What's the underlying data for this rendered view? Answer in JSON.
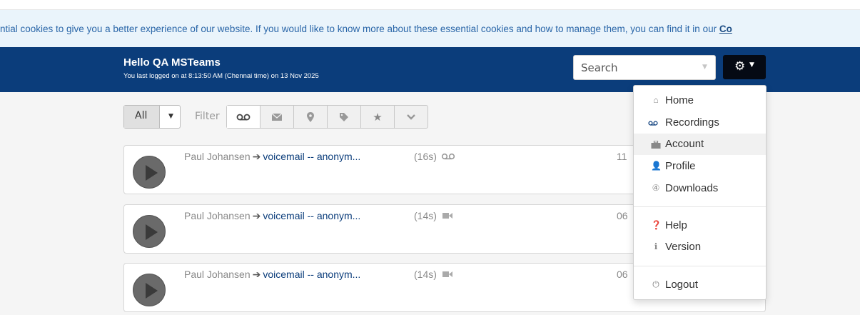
{
  "cookie_banner": {
    "text": "ntial cookies to give you a better experience of our website. If you would like to know more about these essential cookies and how to manage them, you can find it in our ",
    "link": "Co"
  },
  "navbar": {
    "greeting": "Hello QA MSTeams",
    "last_login": "You last logged on at 8:13:50 AM (Chennai time) on 13 Nov 2025",
    "search_placeholder": "Search",
    "gear_icon": "gear-icon"
  },
  "toolbar": {
    "all_label": "All",
    "filter_label": "Filter",
    "filter_icons": [
      "voicemail-icon",
      "envelope-icon",
      "map-marker-icon",
      "tag-icon",
      "star-icon",
      "chevron-down-icon"
    ]
  },
  "messages": [
    {
      "from": "Paul Johansen",
      "to": "voicemail -- anonym...",
      "duration": "(16s)",
      "type_icon": "voicemail-icon",
      "date": "11"
    },
    {
      "from": "Paul Johansen",
      "to": "voicemail -- anonym...",
      "duration": "(14s)",
      "type_icon": "video-icon",
      "date": "06"
    },
    {
      "from": "Paul Johansen",
      "to": "voicemail -- anonym...",
      "duration": "(14s)",
      "type_icon": "video-icon",
      "date": "06"
    }
  ],
  "menu": {
    "items": [
      {
        "label": "Home",
        "icon": "home-icon"
      },
      {
        "label": "Recordings",
        "icon": "voicemail-icon"
      },
      {
        "label": "Account",
        "icon": "briefcase-icon"
      },
      {
        "label": "Profile",
        "icon": "user-icon"
      },
      {
        "label": "Downloads",
        "icon": "download-icon"
      },
      {
        "label": "Help",
        "icon": "question-icon"
      },
      {
        "label": "Version",
        "icon": "info-icon"
      },
      {
        "label": "Logout",
        "icon": "power-icon"
      }
    ]
  },
  "colors": {
    "navbar": "#0b3d7b",
    "cookie_bg": "#eaf4fb",
    "link": "#0b3d7b"
  }
}
